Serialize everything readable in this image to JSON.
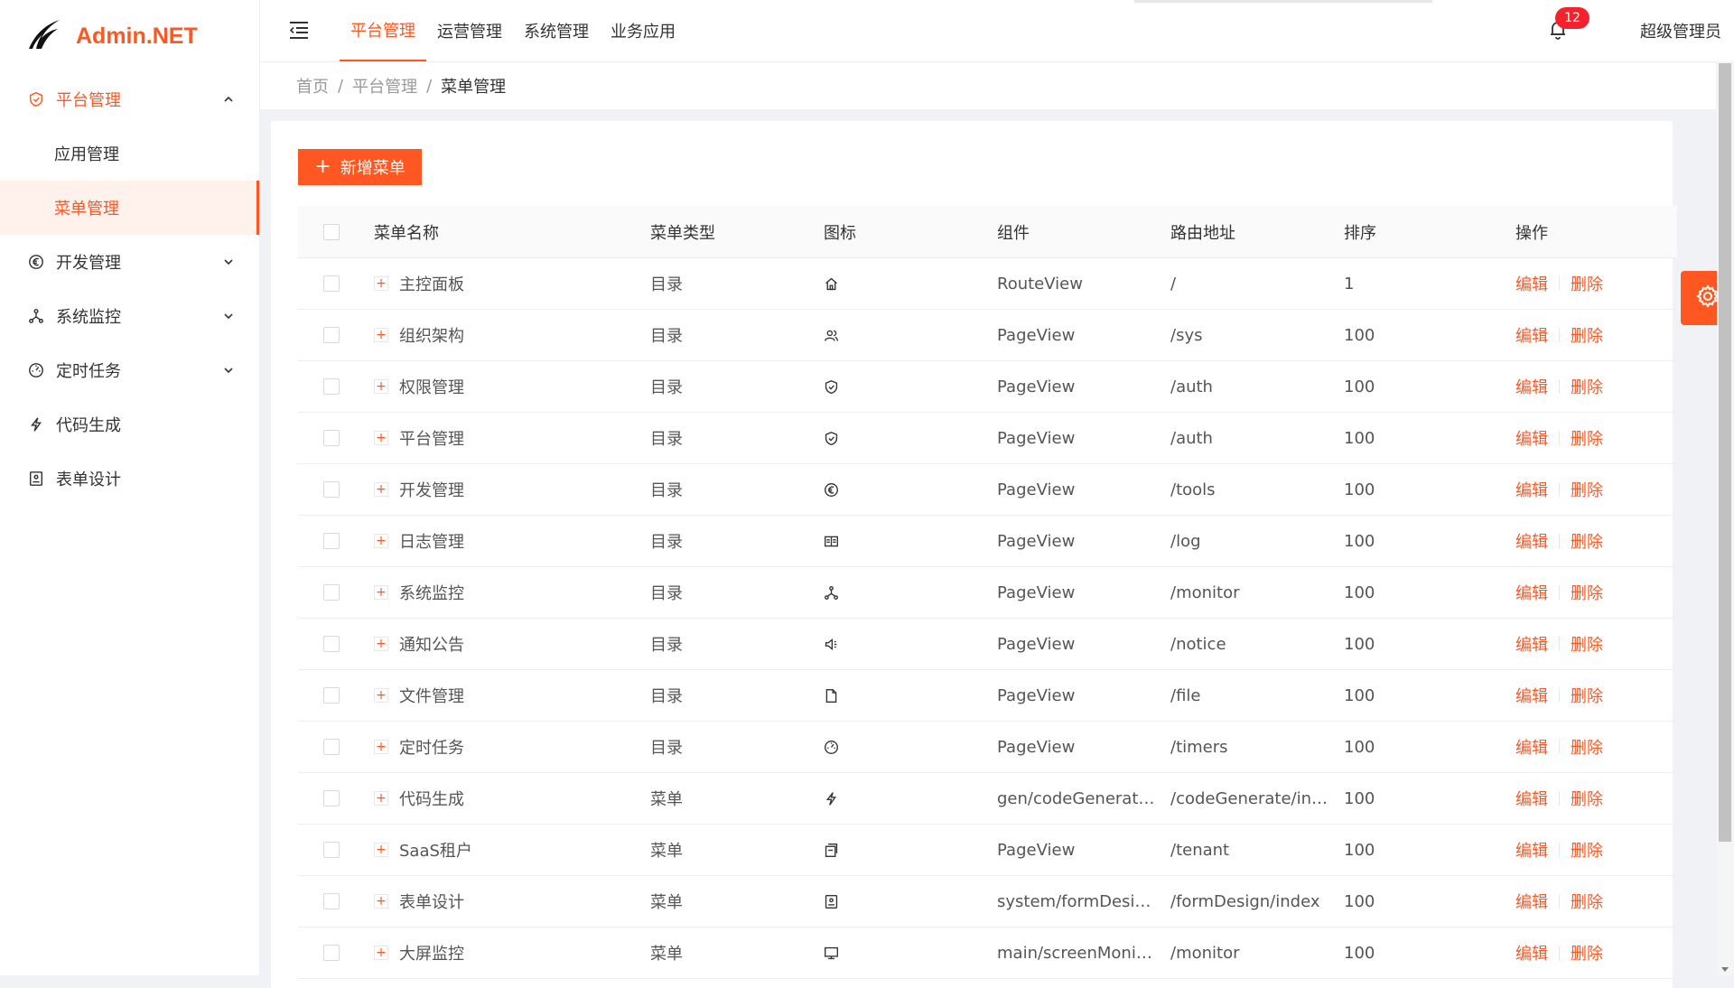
{
  "app": {
    "title": "Admin.NET",
    "logo_icon": "logo-bird-icon"
  },
  "sidebar": {
    "items": [
      {
        "label": "平台管理",
        "icon": "shield-icon",
        "expanded": true,
        "active": true,
        "children": [
          {
            "label": "应用管理",
            "active": false
          },
          {
            "label": "菜单管理",
            "active": true
          }
        ]
      },
      {
        "label": "开发管理",
        "icon": "euro-circle-icon",
        "expanded": false
      },
      {
        "label": "系统监控",
        "icon": "cluster-icon",
        "expanded": false
      },
      {
        "label": "定时任务",
        "icon": "dashboard-icon",
        "expanded": false
      },
      {
        "label": "代码生成",
        "icon": "lightning-icon"
      },
      {
        "label": "表单设计",
        "icon": "form-icon"
      }
    ]
  },
  "header": {
    "tabs": [
      {
        "label": "平台管理",
        "active": true
      },
      {
        "label": "运营管理",
        "active": false
      },
      {
        "label": "系统管理",
        "active": false
      },
      {
        "label": "业务应用",
        "active": false
      }
    ],
    "notifications": "12",
    "user": "超级管理员"
  },
  "breadcrumb": {
    "home": "首页",
    "parent": "平台管理",
    "current": "菜单管理",
    "sep": "/"
  },
  "toolbar": {
    "add_label": "新增菜单"
  },
  "table": {
    "columns": {
      "name": "菜单名称",
      "type": "菜单类型",
      "icon": "图标",
      "component": "组件",
      "path": "路由地址",
      "order": "排序",
      "ops": "操作"
    },
    "edit_label": "编辑",
    "delete_label": "删除",
    "rows": [
      {
        "name": "主控面板",
        "type": "目录",
        "icon": "home-icon",
        "component": "RouteView",
        "path": "/",
        "order": "1"
      },
      {
        "name": "组织架构",
        "type": "目录",
        "icon": "team-icon",
        "component": "PageView",
        "path": "/sys",
        "order": "100"
      },
      {
        "name": "权限管理",
        "type": "目录",
        "icon": "safety-icon",
        "component": "PageView",
        "path": "/auth",
        "order": "100"
      },
      {
        "name": "平台管理",
        "type": "目录",
        "icon": "safety-icon",
        "component": "PageView",
        "path": "/auth",
        "order": "100"
      },
      {
        "name": "开发管理",
        "type": "目录",
        "icon": "euro-circle-icon",
        "component": "PageView",
        "path": "/tools",
        "order": "100"
      },
      {
        "name": "日志管理",
        "type": "目录",
        "icon": "read-icon",
        "component": "PageView",
        "path": "/log",
        "order": "100"
      },
      {
        "name": "系统监控",
        "type": "目录",
        "icon": "cluster-icon",
        "component": "PageView",
        "path": "/monitor",
        "order": "100"
      },
      {
        "name": "通知公告",
        "type": "目录",
        "icon": "sound-icon",
        "component": "PageView",
        "path": "/notice",
        "order": "100"
      },
      {
        "name": "文件管理",
        "type": "目录",
        "icon": "file-icon",
        "component": "PageView",
        "path": "/file",
        "order": "100"
      },
      {
        "name": "定时任务",
        "type": "目录",
        "icon": "dashboard-icon",
        "component": "PageView",
        "path": "/timers",
        "order": "100"
      },
      {
        "name": "代码生成",
        "type": "菜单",
        "icon": "lightning-icon",
        "component": "gen/codeGenerate/i...",
        "path": "/codeGenerate/index",
        "order": "100"
      },
      {
        "name": "SaaS租户",
        "type": "菜单",
        "icon": "switcher-icon",
        "component": "PageView",
        "path": "/tenant",
        "order": "100"
      },
      {
        "name": "表单设计",
        "type": "菜单",
        "icon": "form-icon",
        "component": "system/formDesign/...",
        "path": "/formDesign/index",
        "order": "100"
      },
      {
        "name": "大屏监控",
        "type": "菜单",
        "icon": "desktop-icon",
        "component": "main/screenMonitor...",
        "path": "/monitor",
        "order": "100"
      }
    ]
  },
  "colors": {
    "accent": "#ff5722",
    "badge": "#f5222d",
    "active_bg": "#fff1eb"
  }
}
